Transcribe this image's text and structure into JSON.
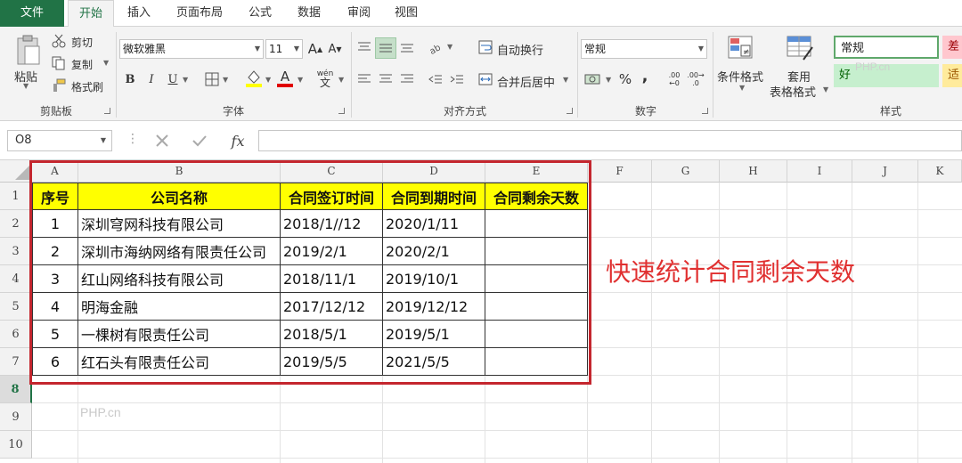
{
  "ribbon": {
    "tabs": [
      "文件",
      "开始",
      "插入",
      "页面布局",
      "公式",
      "数据",
      "审阅",
      "视图"
    ],
    "clipboard": {
      "paste": "粘贴",
      "cut": "剪切",
      "copy": "复制",
      "format_painter": "格式刷",
      "group": "剪贴板"
    },
    "font": {
      "name": "微软雅黑",
      "size": "11",
      "bold": "B",
      "italic": "I",
      "underline": "U",
      "grow": "A",
      "shrink": "A",
      "font_color": "A",
      "phonetic": "wén",
      "group": "字体"
    },
    "alignment": {
      "wrap": "自动换行",
      "merge": "合并后居中",
      "group": "对齐方式"
    },
    "number": {
      "format": "常规",
      "percent": "%",
      "comma": ",",
      "inc_dec": ".00",
      "group": "数字"
    },
    "styles": {
      "conditional": "条件格式",
      "table_line1": "套用",
      "table_line2": "表格格式",
      "normal": "常规",
      "bad": "差",
      "good": "好",
      "neutral": "适",
      "group": "样式",
      "normal_color": "#ffffff",
      "bad_color": "#ffc7ce",
      "good_color": "#c6efce",
      "neutral_color": "#ffeb9c"
    }
  },
  "formula_bar": {
    "name_box": "O8",
    "fx": "fx",
    "value": ""
  },
  "grid": {
    "columns": [
      "A",
      "B",
      "C",
      "D",
      "E",
      "F",
      "G",
      "H",
      "I",
      "J",
      "K"
    ],
    "rows": [
      "1",
      "2",
      "3",
      "4",
      "5",
      "6",
      "7",
      "8",
      "9",
      "10"
    ],
    "selected_row": "8",
    "header": [
      "序号",
      "公司名称",
      "合同签订时间",
      "合同到期时间",
      "合同剩余天数"
    ],
    "data": [
      [
        "1",
        "深圳穹网科技有限公司",
        "2018/1//12",
        "2020/1/11",
        ""
      ],
      [
        "2",
        "深圳市海纳网络有限责任公司",
        "2019/2/1",
        "2020/2/1",
        ""
      ],
      [
        "3",
        "红山网络科技有限公司",
        "2018/11/1",
        "2019/10/1",
        ""
      ],
      [
        "4",
        "明海金融",
        "2017/12/12",
        "2019/12/12",
        ""
      ],
      [
        "5",
        "一棵树有限责任公司",
        "2018/5/1",
        "2019/5/1",
        ""
      ],
      [
        "6",
        "红石头有限责任公司",
        "2019/5/5",
        "2021/5/5",
        ""
      ]
    ]
  },
  "annotation": "快速统计合同剩余天数",
  "watermark": "PHP.cn",
  "watermark2": "PHP.cn",
  "colors": {
    "accent": "#217346",
    "header_fill": "#ffff00",
    "frame": "#c4262e",
    "annotation": "#e03030"
  }
}
